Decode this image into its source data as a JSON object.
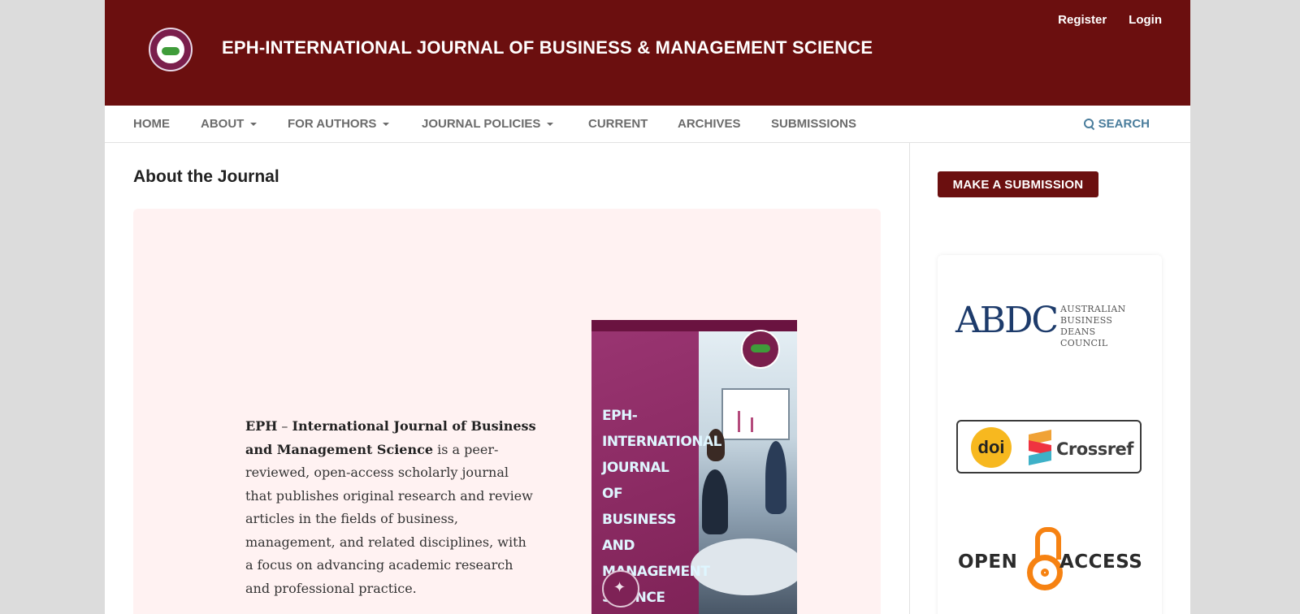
{
  "header": {
    "site_title": "EPH-INTERNATIONAL JOURNAL OF BUSINESS & MANAGEMENT SCIENCE",
    "user_nav": {
      "register": "Register",
      "login": "Login"
    }
  },
  "nav": {
    "items": [
      {
        "label": "HOME",
        "dropdown": false
      },
      {
        "label": "ABOUT",
        "dropdown": true
      },
      {
        "label": "FOR AUTHORS",
        "dropdown": true
      },
      {
        "label": "JOURNAL POLICIES",
        "dropdown": true
      },
      {
        "label": "CURRENT",
        "dropdown": false
      },
      {
        "label": "ARCHIVES",
        "dropdown": false
      },
      {
        "label": "SUBMISSIONS",
        "dropdown": false
      }
    ],
    "search_label": "SEARCH"
  },
  "main": {
    "title": "About the Journal",
    "about": {
      "journal_name_part1": "EPH",
      "dash": " – ",
      "journal_name_part2": "International Journal of Business and Management Science",
      "description": " is a peer-reviewed, open-access scholarly journal that publishes original research and review articles in the fields of business, management, and related disciplines, with a focus on advancing academic research and professional practice."
    },
    "cover": {
      "title_lines": [
        "EPH-",
        "INTERNATIONAL",
        "JOURNAL OF",
        "BUSINESS AND",
        "MANAGEMENT",
        "SCIENCE"
      ]
    }
  },
  "sidebar": {
    "submit_label": "MAKE A SUBMISSION",
    "abdc": {
      "letters": "ABDC",
      "line1": "AUSTRALIAN",
      "line2": "BUSINESS DEANS",
      "line3": "COUNCIL"
    },
    "doi_label": "doi",
    "crossref_label": "Crossref",
    "open_access": {
      "left": "OPEN",
      "right": "ACCESS"
    }
  },
  "colors": {
    "brand": "#6b0f0f",
    "accent_link": "#4a7d9c",
    "card_bg": "#fff2f2"
  }
}
